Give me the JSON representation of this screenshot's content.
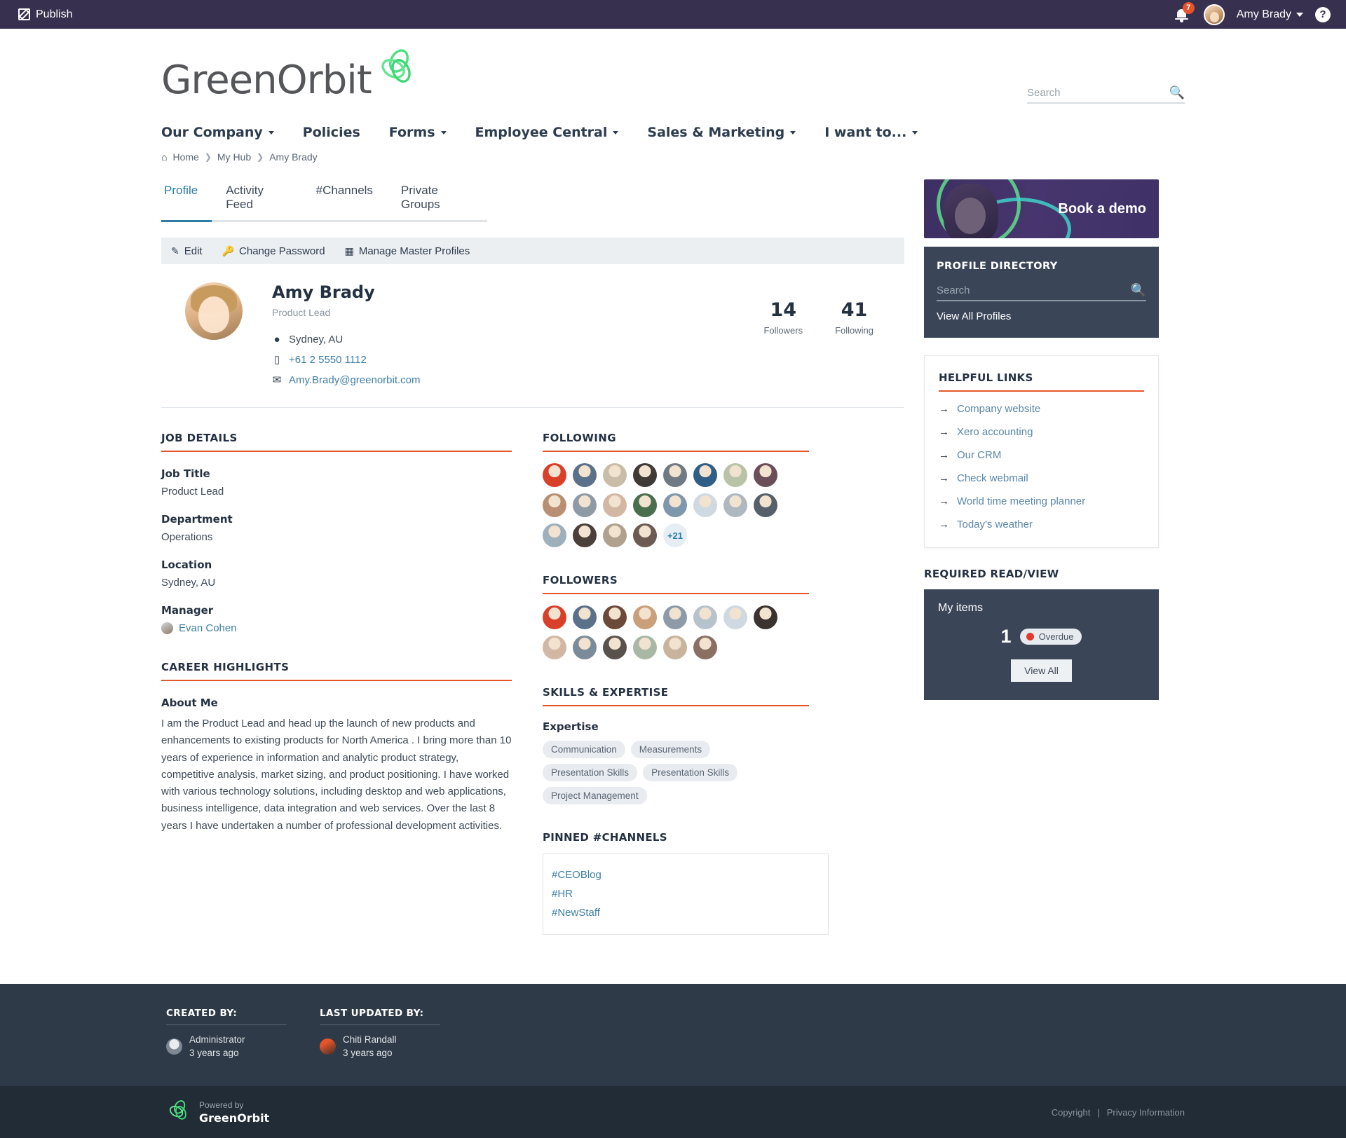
{
  "admin_bar": {
    "publish_label": "Publish",
    "notification_count": "7",
    "user_name": "Amy Brady",
    "help_label": "?"
  },
  "masthead": {
    "logo_text": "GreenOrbit",
    "search_placeholder": "Search",
    "search_value": ""
  },
  "main_nav": [
    {
      "label": "Our Company",
      "has_caret": true
    },
    {
      "label": "Policies",
      "has_caret": false
    },
    {
      "label": "Forms",
      "has_caret": true
    },
    {
      "label": "Employee Central",
      "has_caret": true
    },
    {
      "label": "Sales & Marketing",
      "has_caret": true
    },
    {
      "label": "I want to...",
      "has_caret": true
    }
  ],
  "breadcrumb": [
    "Home",
    "My Hub",
    "Amy Brady"
  ],
  "profile_tabs": [
    {
      "label": "Profile",
      "active": true
    },
    {
      "label": "Activity Feed",
      "active": false
    },
    {
      "label": "#Channels",
      "active": false
    },
    {
      "label": "Private Groups",
      "active": false
    }
  ],
  "action_bar": [
    {
      "label": "Edit",
      "icon": "pencil-icon"
    },
    {
      "label": "Change Password",
      "icon": "key-icon"
    },
    {
      "label": "Manage Master Profiles",
      "icon": "profiles-icon"
    }
  ],
  "profile": {
    "name": "Amy Brady",
    "title": "Product Lead",
    "location": "Sydney, AU",
    "phone": "+61 2 5550 1112",
    "email": "Amy.Brady@greenorbit.com",
    "followers_count": "14",
    "followers_label": "Followers",
    "following_count": "41",
    "following_label": "Following"
  },
  "job_details": {
    "section_title": "JOB DETAILS",
    "fields": [
      {
        "label": "Job Title",
        "value": "Product Lead"
      },
      {
        "label": "Department",
        "value": "Operations"
      },
      {
        "label": "Location",
        "value": "Sydney, AU"
      }
    ],
    "manager_label": "Manager",
    "manager_name": "Evan Cohen"
  },
  "career_highlights": {
    "section_title": "CAREER HIGHLIGHTS",
    "about_label": "About Me",
    "about_text": "I am the Product Lead and head up the launch of new products and enhancements to existing products for North America . I bring more than 10 years of experience in information and analytic product strategy, competitive analysis, market sizing, and product positioning. I have worked with various technology solutions, including desktop and web applications, business intelligence, data integration and web services. Over the last 8 years I have undertaken a number of professional development activities."
  },
  "following": {
    "section_title": "FOLLOWING",
    "more_label": "+21",
    "avatar_colors": [
      "#d8402a",
      "#5b7189",
      "#c9bda8",
      "#3f3a36",
      "#6f7a84",
      "#2f5f86",
      "#b9c3a8",
      "#6b4f58",
      "#b98f74",
      "#8e9aa6",
      "#d3b7a5",
      "#4a6f4e",
      "#7e97ad",
      "#cfd9e2",
      "#aeb8bf",
      "#55606b",
      "#9fb0bd",
      "#4b3f3a",
      "#b0a18f",
      "#6d5a52"
    ]
  },
  "followers": {
    "section_title": "FOLLOWERS",
    "avatar_colors": [
      "#d8402a",
      "#5b7189",
      "#6b4a3a",
      "#c9a07a",
      "#8d9ba8",
      "#b6c2cc",
      "#cfd9e2",
      "#3a332f",
      "#d3b7a5",
      "#7b8b99",
      "#59524c",
      "#a9b8a4",
      "#c8b49c",
      "#8a7063"
    ]
  },
  "skills": {
    "section_title": "SKILLS & EXPERTISE",
    "expertise_label": "Expertise",
    "tags": [
      "Communication",
      "Measurements",
      "Presentation Skills",
      "Presentation Skills",
      "Project Management"
    ]
  },
  "pinned_channels": {
    "section_title": "PINNED #CHANNELS",
    "channels": [
      "#CEOBlog",
      "#HR",
      "#NewStaff"
    ]
  },
  "sidebar": {
    "demo_banner_text": "Book a demo",
    "directory": {
      "title": "PROFILE DIRECTORY",
      "search_placeholder": "Search",
      "search_value": "",
      "view_all_label": "View All Profiles"
    },
    "helpful_links": {
      "title": "HELPFUL LINKS",
      "items": [
        "Company website",
        "Xero accounting",
        "Our CRM",
        "Check webmail",
        "World time meeting planner",
        "Today's weather"
      ]
    },
    "required": {
      "title": "REQUIRED READ/VIEW",
      "my_items_label": "My items",
      "count": "1",
      "badge_label": "Overdue",
      "button_label": "View All"
    }
  },
  "footer": {
    "created_by": {
      "heading": "CREATED BY:",
      "name": "Administrator",
      "time": "3 years ago"
    },
    "last_updated_by": {
      "heading": "LAST UPDATED BY:",
      "name": "Chiti Randall",
      "time": "3 years ago"
    },
    "powered_by_small": "Powered by",
    "powered_by_big": "GreenOrbit",
    "copyright_label": "Copyright",
    "separator": "|",
    "privacy_label": "Privacy Information"
  },
  "colors": {
    "admin_bar": "#38304f",
    "accent_orange": "#e8542a",
    "link_blue": "#3f7fa6",
    "tab_active": "#2b7da8",
    "dark_panel": "#3a4658",
    "footer_top": "#2e3a47",
    "footer_bottom": "#222c36",
    "logo_green": "#4ee07f"
  }
}
